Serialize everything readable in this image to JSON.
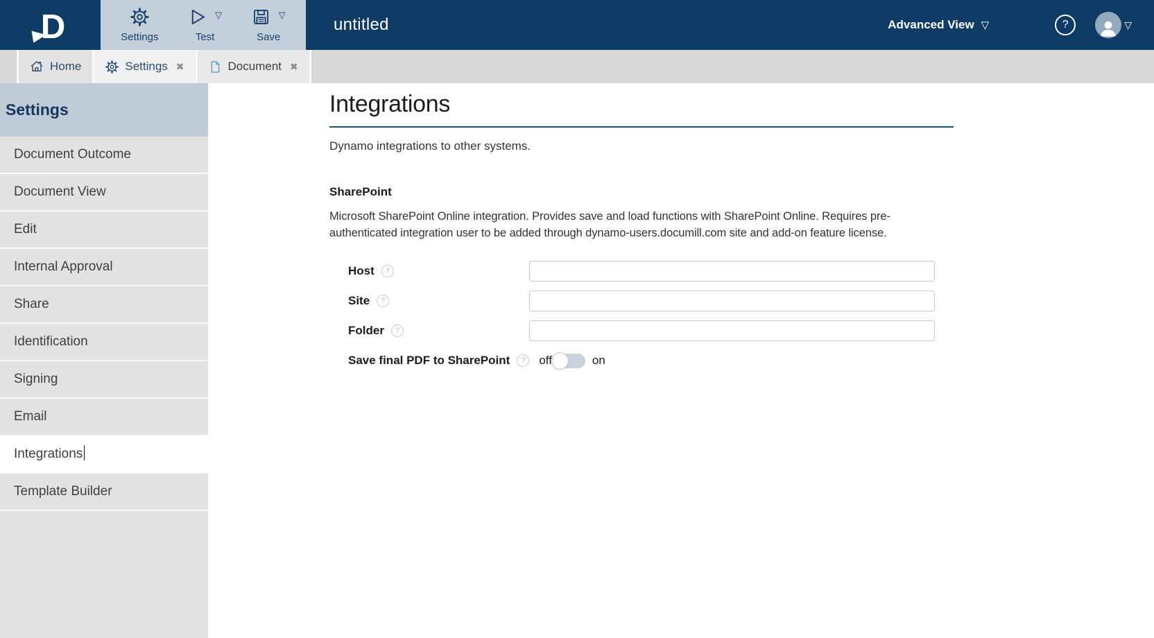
{
  "icons": {
    "dropdown_glyph": "▽",
    "close_glyph": "✖",
    "help_glyph": "?"
  },
  "colors": {
    "topbar_navy": "#0e3c66",
    "toolbar_panel_bg": "#c3cfda",
    "accent_navy": "#1d4068",
    "document_icon_blue": "#4d9fd6",
    "sidebar_header_bg": "#bfccd7",
    "sidebar_item_bg": "#e2e2e2",
    "heading_underline": "#1f4e79",
    "toggle_track": "#c9d2dc",
    "avatar_bg": "#93a9bd"
  },
  "topbar": {
    "title": "untitled",
    "buttons": [
      {
        "label": "Settings",
        "icon": "gear-icon"
      },
      {
        "label": "Test",
        "icon": "play-icon",
        "has_dropdown": true
      },
      {
        "label": "Save",
        "icon": "save-icon",
        "has_dropdown": true
      }
    ],
    "view_selector_label": "Advanced View"
  },
  "tabbar": {
    "tabs": [
      {
        "label": "Home",
        "icon": "home-icon",
        "closable": false,
        "active": false
      },
      {
        "label": "Settings",
        "icon": "gear-icon",
        "closable": true,
        "active": true
      },
      {
        "label": "Document",
        "icon": "document-icon",
        "closable": true,
        "active": false
      }
    ]
  },
  "sidebar": {
    "header": "Settings",
    "items": [
      {
        "label": "Document Outcome",
        "selected": false
      },
      {
        "label": "Document View",
        "selected": false
      },
      {
        "label": "Edit",
        "selected": false
      },
      {
        "label": "Internal Approval",
        "selected": false
      },
      {
        "label": "Share",
        "selected": false
      },
      {
        "label": "Identification",
        "selected": false
      },
      {
        "label": "Signing",
        "selected": false
      },
      {
        "label": "Email",
        "selected": false
      },
      {
        "label": "Integrations",
        "selected": true
      },
      {
        "label": "Template Builder",
        "selected": false
      }
    ]
  },
  "main": {
    "title": "Integrations",
    "subtitle": "Dynamo integrations to other systems.",
    "sharepoint": {
      "heading": "SharePoint",
      "description": "Microsoft SharePoint Online integration. Provides save and load functions with SharePoint Online. Requires pre-authenticated integration user to be added through dynamo-users.documill.com site and add-on feature license.",
      "fields": {
        "host": {
          "label": "Host",
          "value": "",
          "placeholder": ""
        },
        "site": {
          "label": "Site",
          "value": "",
          "placeholder": ""
        },
        "folder": {
          "label": "Folder",
          "value": "",
          "placeholder": ""
        },
        "save_pdf": {
          "label": "Save final PDF to SharePoint",
          "state": "off",
          "off_label": "off",
          "on_label": "on"
        }
      }
    }
  }
}
